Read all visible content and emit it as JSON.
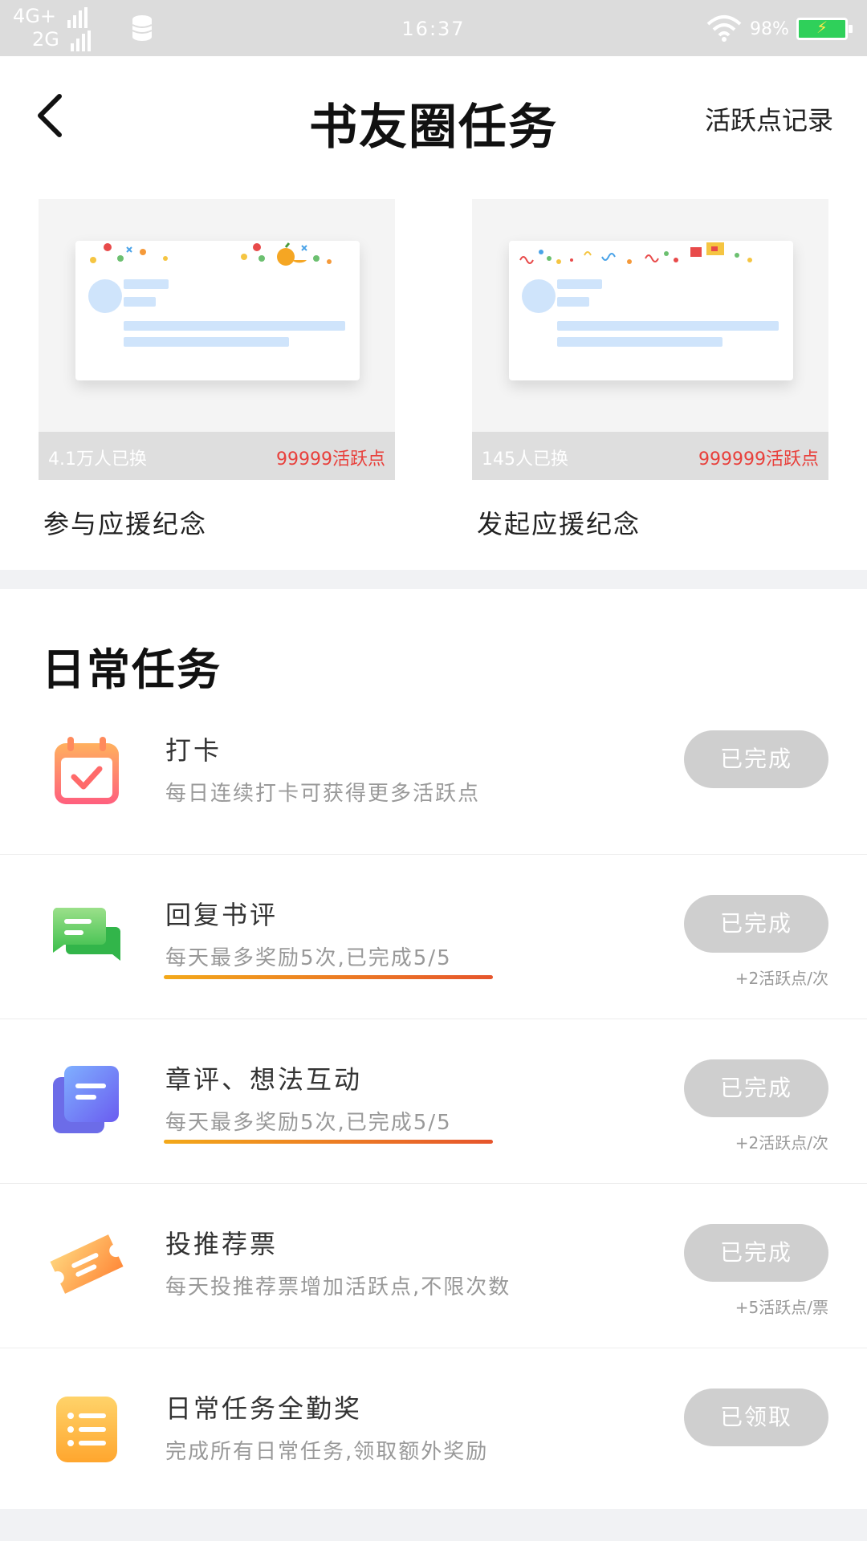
{
  "status_bar": {
    "net1": "4G+",
    "net2": "2G",
    "time": "16:37",
    "battery": "98%"
  },
  "header": {
    "title": "书友圈任务",
    "right_link": "活跃点记录"
  },
  "souvenirs": [
    {
      "count": "4.1万人已换",
      "points": "99999活跃点",
      "label": "参与应援纪念"
    },
    {
      "count": "145人已换",
      "points": "999999活跃点",
      "label": "发起应援纪念"
    }
  ],
  "daily": {
    "title": "日常任务",
    "tasks": [
      {
        "title": "打卡",
        "desc": "每日连续打卡可获得更多活跃点",
        "button": "已完成",
        "note": "",
        "icon": "calendar-check-icon"
      },
      {
        "title": "回复书评",
        "desc": "每天最多奖励5次,已完成5/5",
        "button": "已完成",
        "note": "+2活跃点/次",
        "icon": "chat-bubbles-icon"
      },
      {
        "title": "章评、想法互动",
        "desc": "每天最多奖励5次,已完成5/5",
        "button": "已完成",
        "note": "+2活跃点/次",
        "icon": "notes-icon"
      },
      {
        "title": "投推荐票",
        "desc": "每天投推荐票增加活跃点,不限次数",
        "button": "已完成",
        "note": "+5活跃点/票",
        "icon": "ticket-icon"
      },
      {
        "title": "日常任务全勤奖",
        "desc": "完成所有日常任务,领取额外奖励",
        "button": "已领取",
        "note": "",
        "icon": "list-icon"
      }
    ]
  },
  "colors": {
    "button_done": "#cfcfcf",
    "points_red": "#e8413c",
    "progress_underline": "#ef7a24"
  }
}
